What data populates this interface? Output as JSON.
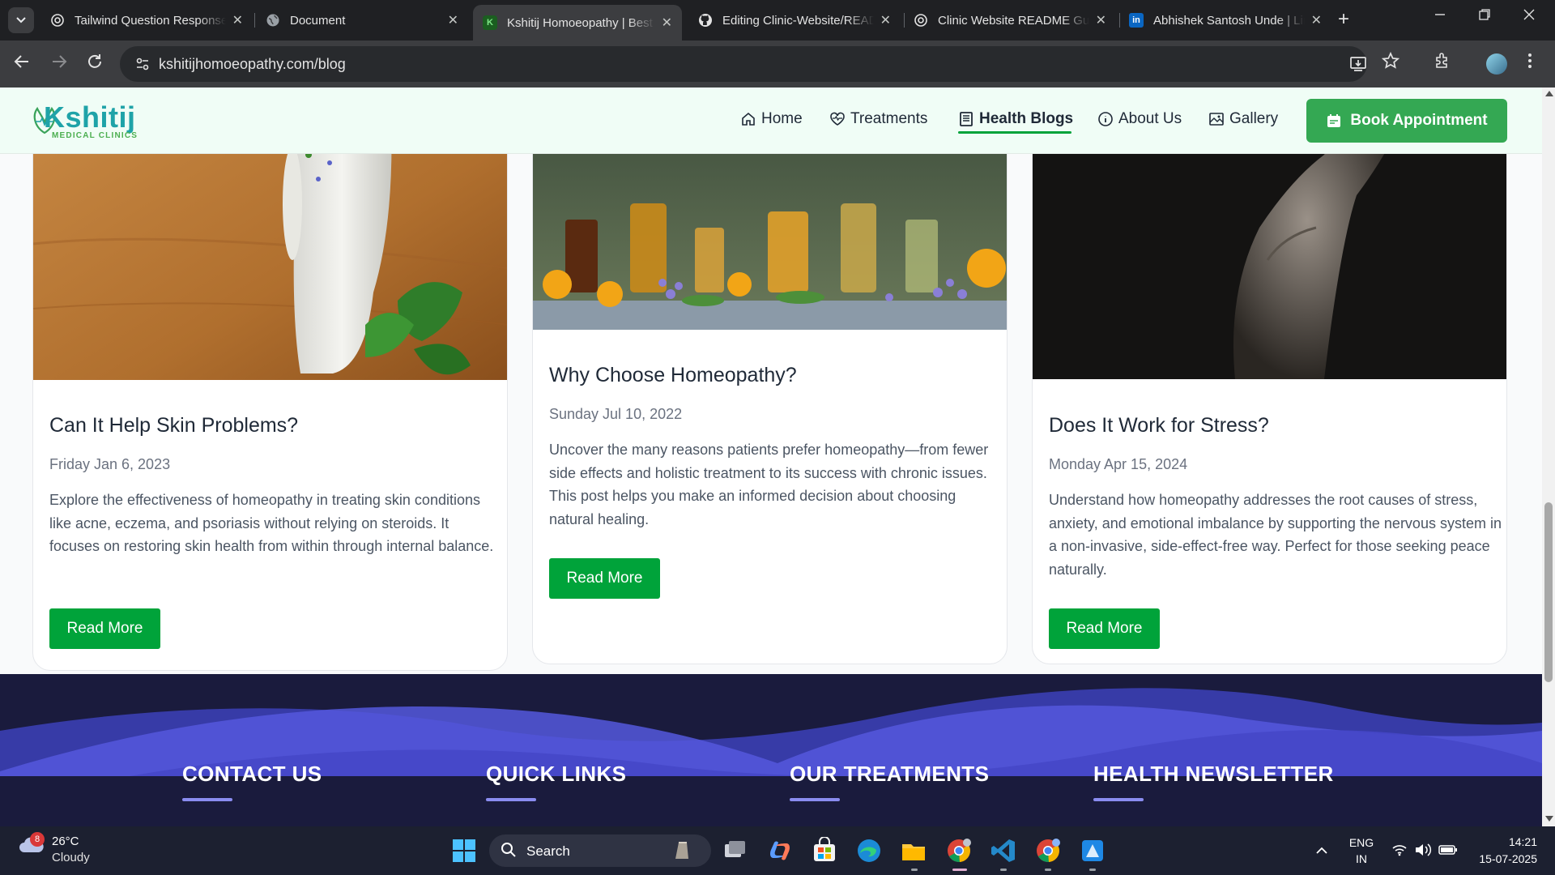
{
  "browser": {
    "tabs": [
      {
        "label": "Tailwind Question Response",
        "favicon": "chatgpt-icon",
        "active": false
      },
      {
        "label": "Document",
        "favicon": "globe-icon",
        "active": false
      },
      {
        "label": "Kshitij Homoeopathy | Best Homoeopathy",
        "favicon": "k-favicon",
        "active": true
      },
      {
        "label": "Editing Clinic-Website/README",
        "favicon": "github-icon",
        "active": false
      },
      {
        "label": "Clinic Website README Guide",
        "favicon": "chatgpt-icon",
        "active": false
      },
      {
        "label": "Abhishek Santosh Unde | LinkedIn",
        "favicon": "linkedin-icon",
        "active": false
      }
    ],
    "favicon_letter": "K",
    "linkedin_letters": "in",
    "new_tab_glyph": "+",
    "close_glyph": "✕",
    "url": "kshitijhomoeopathy.com/blog"
  },
  "site": {
    "logo_text": "Kshitij",
    "logo_sub": "MEDICAL CLINICS",
    "nav": [
      {
        "label": "Home",
        "icon": "home-icon"
      },
      {
        "label": "Treatments",
        "icon": "heart-pulse-icon"
      },
      {
        "label": "Health Blogs",
        "icon": "book-icon",
        "active": true
      },
      {
        "label": "About Us",
        "icon": "info-icon"
      },
      {
        "label": "Gallery",
        "icon": "gallery-icon"
      }
    ],
    "book_label": "Book Appointment",
    "brand_green": "#00a33a"
  },
  "blog_cards": [
    {
      "title": "Can It Help Skin Problems?",
      "date": "Friday Jan 6, 2023",
      "excerpt": "Explore the effectiveness of homeopathy in treating skin conditions like acne, eczema, and psoriasis without relying on steroids. It focuses on restoring skin health from within through internal balance.",
      "button": "Read More"
    },
    {
      "title": "Why Choose Homeopathy?",
      "date": "Sunday Jul 10, 2022",
      "excerpt": "Uncover the many reasons patients prefer homeopathy—from fewer side effects and holistic treatment to its success with chronic issues. This post helps you make an informed decision about choosing natural healing.",
      "button": "Read More"
    },
    {
      "title": "Does It Work for Stress?",
      "date": "Monday Apr 15, 2024",
      "excerpt": "Understand how homeopathy addresses the root causes of stress, anxiety, and emotional imbalance by supporting the nervous system in a non-invasive, side-effect-free way. Perfect for those seeking peace naturally.",
      "button": "Read More"
    }
  ],
  "footer": {
    "columns": [
      "CONTACT US",
      "QUICK LINKS",
      "OUR TREATMENTS",
      "HEALTH NEWSLETTER"
    ]
  },
  "taskbar": {
    "weather_temp": "26°C",
    "weather_desc": "Cloudy",
    "weather_badge": "8",
    "search_label": "Search",
    "lang_top": "ENG",
    "lang_bottom": "IN",
    "time": "14:21",
    "date": "15-07-2025",
    "apps": [
      "start-icon",
      "task-view-icon",
      "copilot-icon",
      "store-icon",
      "edge-icon",
      "file-explorer-icon",
      "chrome-icon",
      "vscode-icon",
      "chrome-profile-icon",
      "app-icon"
    ]
  }
}
